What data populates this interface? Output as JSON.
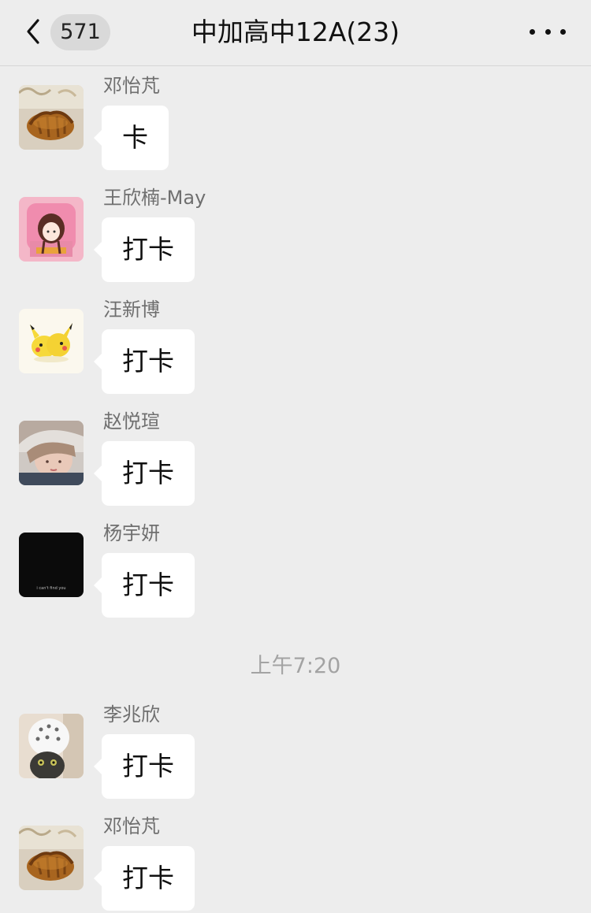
{
  "header": {
    "unread_count": "571",
    "title": "中加高中12A(23)",
    "back_icon": "chevron-left-icon",
    "more_icon": "ellipsis-icon"
  },
  "messages": [
    {
      "sender": "邓怡芃",
      "text": "卡",
      "avatar": "croissant-photo"
    },
    {
      "sender": "王欣楠-May",
      "text": "打卡",
      "avatar": "cartoon-girl-pink"
    },
    {
      "sender": "汪新博",
      "text": "打卡",
      "avatar": "pikachu-pair"
    },
    {
      "sender": "赵悦瑄",
      "text": "打卡",
      "avatar": "portrait-photo"
    },
    {
      "sender": "杨宇妍",
      "text": "打卡",
      "avatar": "black-image-caption",
      "avatar_caption": "i can't find you"
    },
    {
      "sender": "李兆欣",
      "text": "打卡",
      "avatar": "cat-with-white-clog"
    },
    {
      "sender": "邓怡芃",
      "text": "打卡",
      "avatar": "croissant-photo"
    }
  ],
  "timestamp": "上午7:20"
}
